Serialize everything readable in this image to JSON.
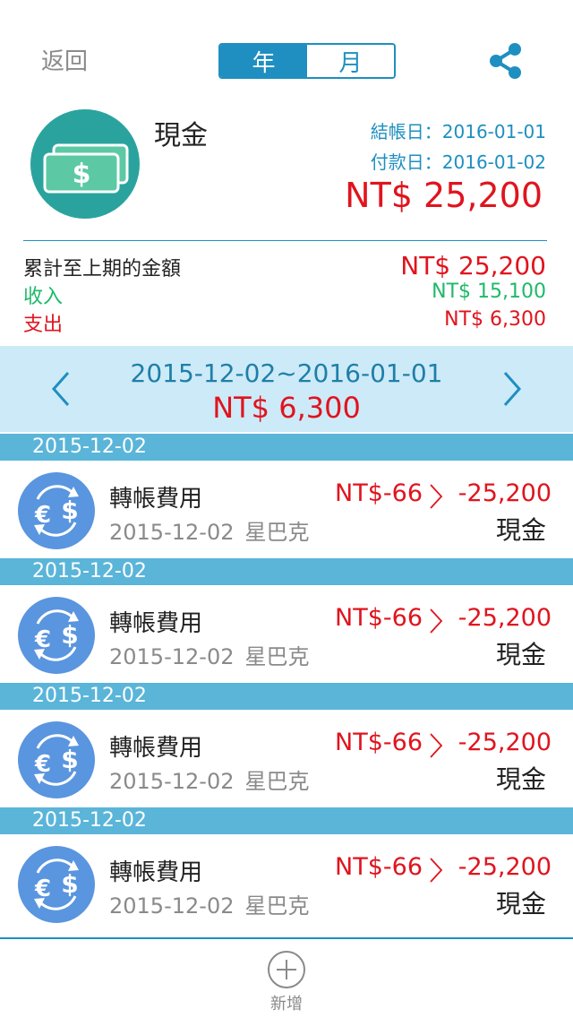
{
  "header": {
    "back_label": "返回",
    "segment_year": "年",
    "segment_month": "月",
    "segment_active": "year"
  },
  "account": {
    "name": "現金",
    "closing_date_label": "結帳日：2016-01-01",
    "payment_date_label": "付款日：2016-01-02",
    "balance": "NT$ 25,200",
    "icon": "cash-icon"
  },
  "summary": {
    "prev_label": "累計至上期的金額",
    "prev_value": "NT$ 25,200",
    "income_label": "收入",
    "income_value": "NT$ 15,100",
    "expense_label": "支出",
    "expense_value": "NT$ 6,300"
  },
  "period": {
    "range": "2015-12-02~2016-01-01",
    "total": "NT$ 6,300"
  },
  "transactions": [
    {
      "date_header": "2015-12-02",
      "category": "轉帳費用",
      "date": "2015-12-02",
      "payee": "星巴克",
      "fee": "NT$-66",
      "amount": "-25,200",
      "account": "現金"
    },
    {
      "date_header": "2015-12-02",
      "category": "轉帳費用",
      "date": "2015-12-02",
      "payee": "星巴克",
      "fee": "NT$-66",
      "amount": "-25,200",
      "account": "現金"
    },
    {
      "date_header": "2015-12-02",
      "category": "轉帳費用",
      "date": "2015-12-02",
      "payee": "星巴克",
      "fee": "NT$-66",
      "amount": "-25,200",
      "account": "現金"
    },
    {
      "date_header": "2015-12-02",
      "category": "轉帳費用",
      "date": "2015-12-02",
      "payee": "星巴克",
      "fee": "NT$-66",
      "amount": "-25,200",
      "account": "現金"
    }
  ],
  "footer": {
    "add_label": "新增"
  },
  "colors": {
    "accent": "#1e8fc0",
    "expense": "#e0141e",
    "income": "#1fb96b",
    "period_bg": "#cdeaf8",
    "date_header_bg": "#5ab5d9"
  }
}
